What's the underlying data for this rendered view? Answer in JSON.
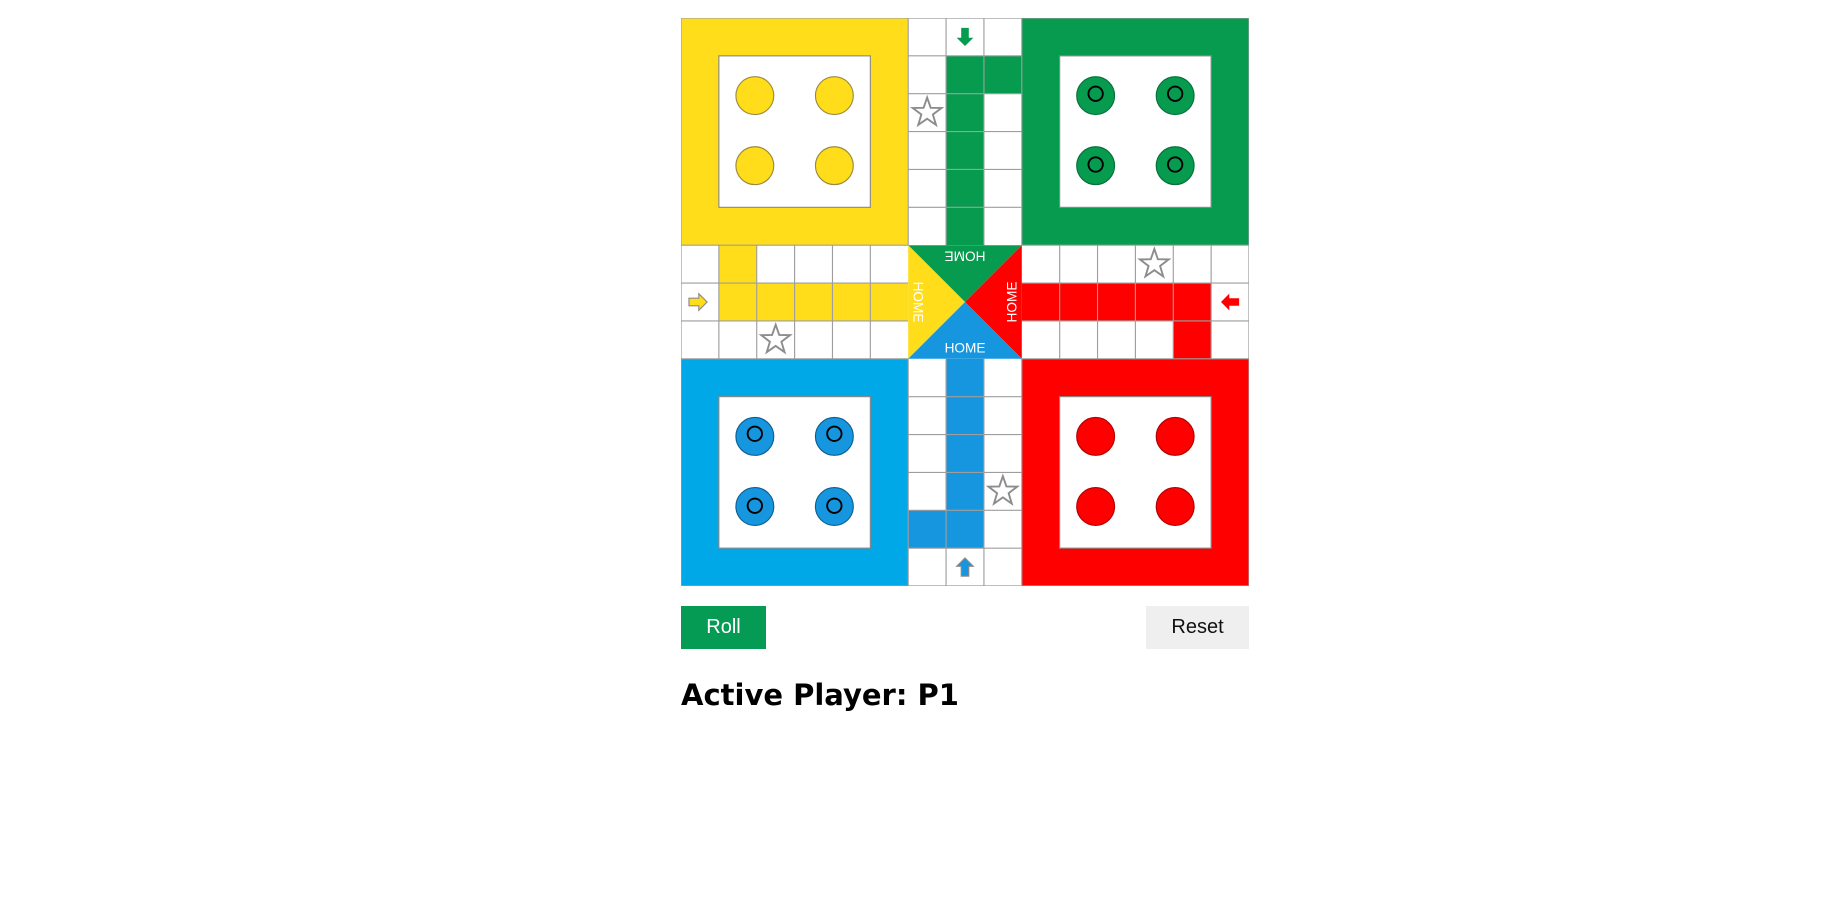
{
  "board": {
    "colors": {
      "yellow": "#ffdd1a",
      "green": "#069b4e",
      "red": "#fe0000",
      "blue": "#00a8e8",
      "blue_token": "#1796e0",
      "cell_line": "#9e9e9e"
    },
    "home_labels": {
      "green": "HOME",
      "yellow": "HOME",
      "red": "HOME",
      "blue": "HOME"
    },
    "tokens": {
      "yellow": {
        "count": 4,
        "style": "plain"
      },
      "green": {
        "count": 4,
        "style": "ringed"
      },
      "blue": {
        "count": 4,
        "style": "ringed"
      },
      "red": {
        "count": 4,
        "style": "plain"
      }
    },
    "entry_arrows": [
      "green-arrow-icon",
      "yellow-arrow-icon",
      "red-arrow-icon",
      "blue-arrow-icon"
    ],
    "safe_spots": 4
  },
  "controls": {
    "roll_label": "Roll",
    "reset_label": "Reset"
  },
  "status": {
    "active_player_text": "Active Player: P1"
  }
}
